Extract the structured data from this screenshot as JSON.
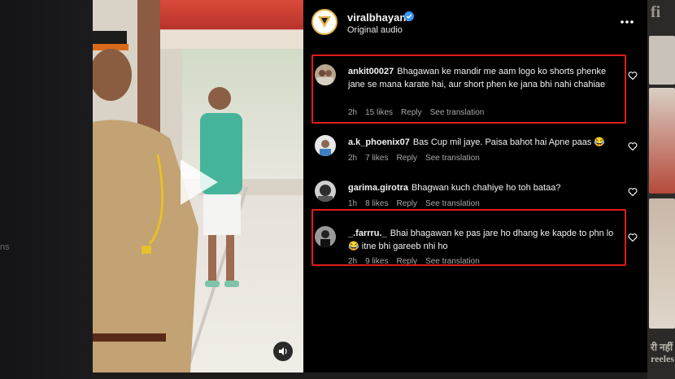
{
  "post": {
    "username": "viralbhayani",
    "audio": "Original audio"
  },
  "backdrop": {
    "left_text": "ns",
    "right_top_text": "fi",
    "right_bottom_text": "री नहीं\nreeles"
  },
  "comments": [
    {
      "user": "ankit00027",
      "text": "Bhagawan ke mandir me aam logo ko shorts phenke jane se mana karate hai, aur short phen ke jana bhi nahi chahiae",
      "age": "2h",
      "likes": "15 likes",
      "reply": "Reply",
      "translate": "See translation"
    },
    {
      "user": "a.k_phoenix07",
      "text": "Bas Cup mil jaye. Paisa bahot hai Apne paas 😂",
      "age": "2h",
      "likes": "7 likes",
      "reply": "Reply",
      "translate": "See translation"
    },
    {
      "user": "garima.girotra",
      "text": "Bhagwan kuch chahiye ho toh bataa?",
      "age": "1h",
      "likes": "8 likes",
      "reply": "Reply",
      "translate": "See translation"
    },
    {
      "user": "_.farrru._",
      "text": "Bhai bhagawan ke pas jare ho dhang ke kapde to phn lo 😂 itne bhi gareeb nhi ho",
      "age": "2h",
      "likes": "9 likes",
      "reply": "Reply",
      "translate": "See translation"
    }
  ],
  "icons": {
    "verified": "verified-badge-icon",
    "more": "more-options-icon",
    "heart": "heart-outline-icon",
    "play": "play-icon",
    "sound": "speaker-icon"
  },
  "colors": {
    "highlight": "#e01b1b",
    "verified": "#3897f0",
    "panel_bg": "#000000"
  }
}
